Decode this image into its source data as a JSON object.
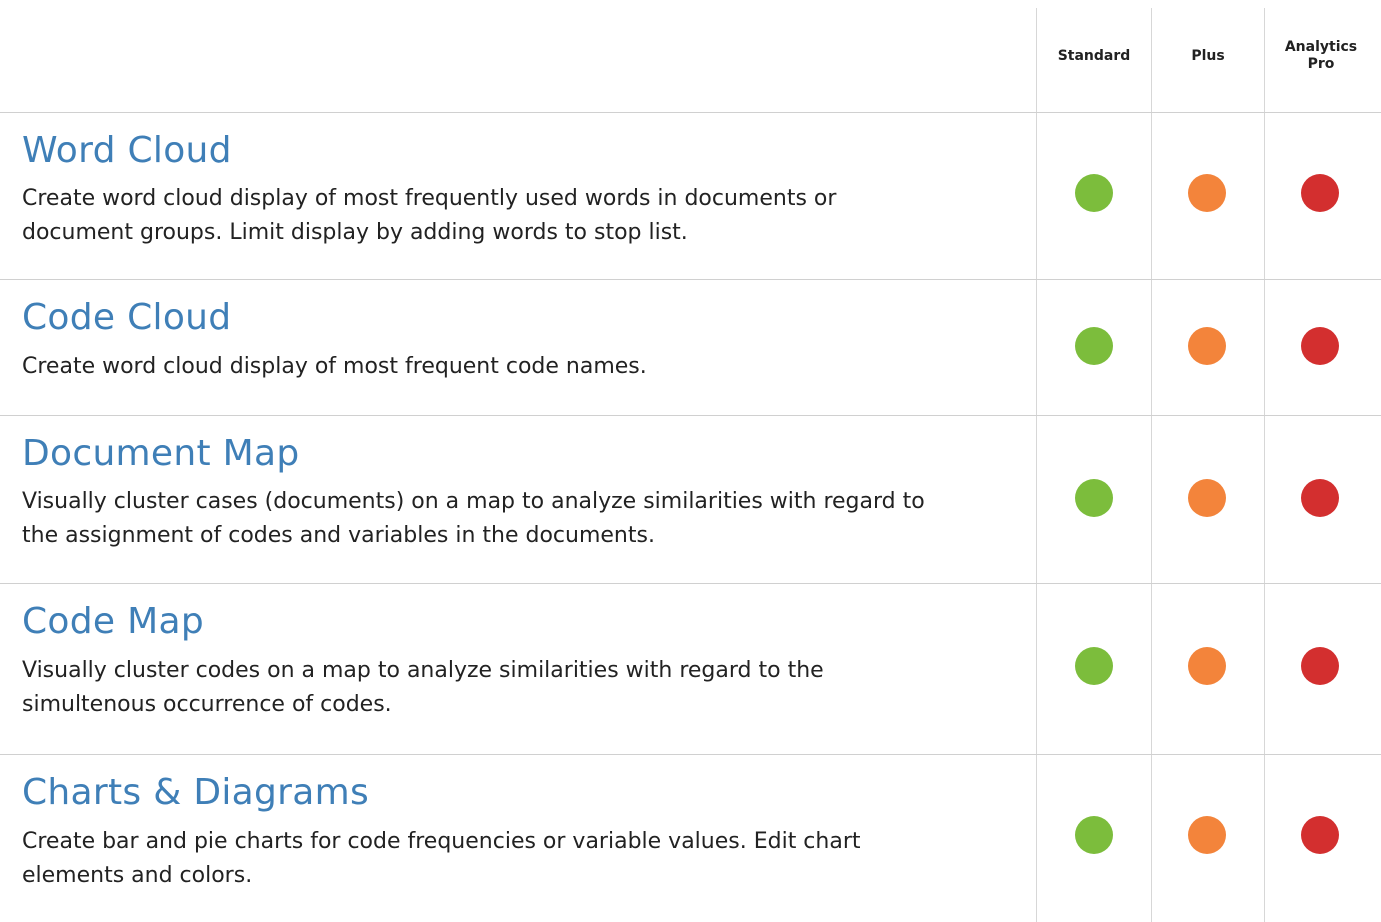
{
  "columns": [
    {
      "label_lines": [
        "Standard"
      ]
    },
    {
      "label_lines": [
        "Plus"
      ]
    },
    {
      "label_lines": [
        "Analytics",
        "Pro"
      ]
    }
  ],
  "colors": {
    "title": "#3f7fb7",
    "standard_dot": "#7cbd3c",
    "plus_dot": "#f3843b",
    "pro_dot": "#d32f2f",
    "divider": "#d0d0d0"
  },
  "features": [
    {
      "title": "Word Cloud",
      "description_lines": [
        "Create word cloud display of most frequently used words in documents or",
        "document groups. Limit display by adding words to stop list."
      ],
      "availability": {
        "standard": true,
        "plus": true,
        "pro": true
      }
    },
    {
      "title": "Code Cloud",
      "description_lines": [
        "Create word cloud display of most frequent code names."
      ],
      "availability": {
        "standard": true,
        "plus": true,
        "pro": true
      }
    },
    {
      "title": "Document Map",
      "description_lines": [
        "Visually cluster cases (documents) on a map to analyze similarities with regard to",
        "the assignment of codes and variables in the documents."
      ],
      "availability": {
        "standard": true,
        "plus": true,
        "pro": true
      }
    },
    {
      "title": "Code Map",
      "description_lines": [
        "Visually cluster codes on a map to analyze similarities with regard to the",
        "simultenous occurrence of codes."
      ],
      "availability": {
        "standard": true,
        "plus": true,
        "pro": true
      }
    },
    {
      "title": "Charts & Diagrams",
      "description_lines": [
        "Create bar and pie charts for code frequencies or variable values. Edit chart",
        "elements and colors."
      ],
      "availability": {
        "standard": true,
        "plus": true,
        "pro": true
      }
    }
  ]
}
